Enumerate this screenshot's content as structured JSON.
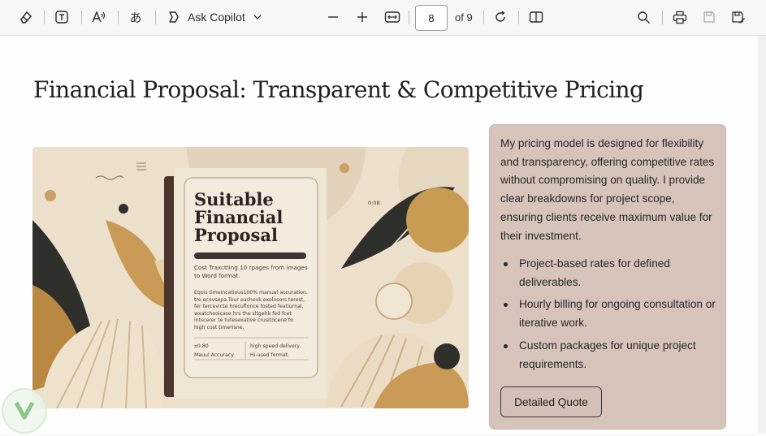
{
  "toolbar": {
    "ask_copilot_label": "Ask Copilot",
    "page_number": "8",
    "page_count_label": "of 9",
    "icons": [
      "eraser-icon",
      "text-box-icon",
      "read-aloud-icon",
      "translate-icon",
      "copilot-icon",
      "chevron-down-icon",
      "zoom-out-icon",
      "zoom-in-icon",
      "fit-width-icon",
      "rotate-icon",
      "page-view-icon",
      "search-icon",
      "print-icon",
      "save-icon",
      "save-as-icon"
    ]
  },
  "document": {
    "title": "Financial Proposal: Transparent & Competitive Pricing",
    "image": {
      "heading_line1": "Suitable",
      "heading_line2": "Financial",
      "heading_line3": "Proposal",
      "subtext_line1": "Cost Traxctting 10 rpages from images",
      "subtext_line2": "to  Word format.",
      "body_line1": "Eqois timeincatious100% manual accuration.",
      "body_line2": "tre ecovsepa.Tour eachovk exolosors terest,",
      "body_line3": "fer tercevicte hrecuflonce fosted featiurnal,",
      "body_line4": "wxatcheoicase hrs the sltgehk fed fcet",
      "body_line5": "intscerer te tutesexative crusitocene to",
      "body_line6": "high cost timerisne.",
      "stat_left_1": "¤0.80",
      "stat_left_2": "Mauul Accuracy",
      "stat_right_1": "high speed delivery",
      "stat_right_2": "Hi-used format.",
      "tiny_label": "0:08"
    },
    "card": {
      "paragraph": "My pricing model is designed for flexibility and transparency, offering competitive rates without compromising on quality. I provide clear breakdowns for project scope, ensuring clients receive maximum value for their investment.",
      "bullets": [
        "Project-based rates for defined deliverables.",
        "Hourly billing for ongoing consultation or iterative work.",
        "Custom packages for unique project requirements."
      ],
      "button_label": "Detailed Quote"
    }
  }
}
